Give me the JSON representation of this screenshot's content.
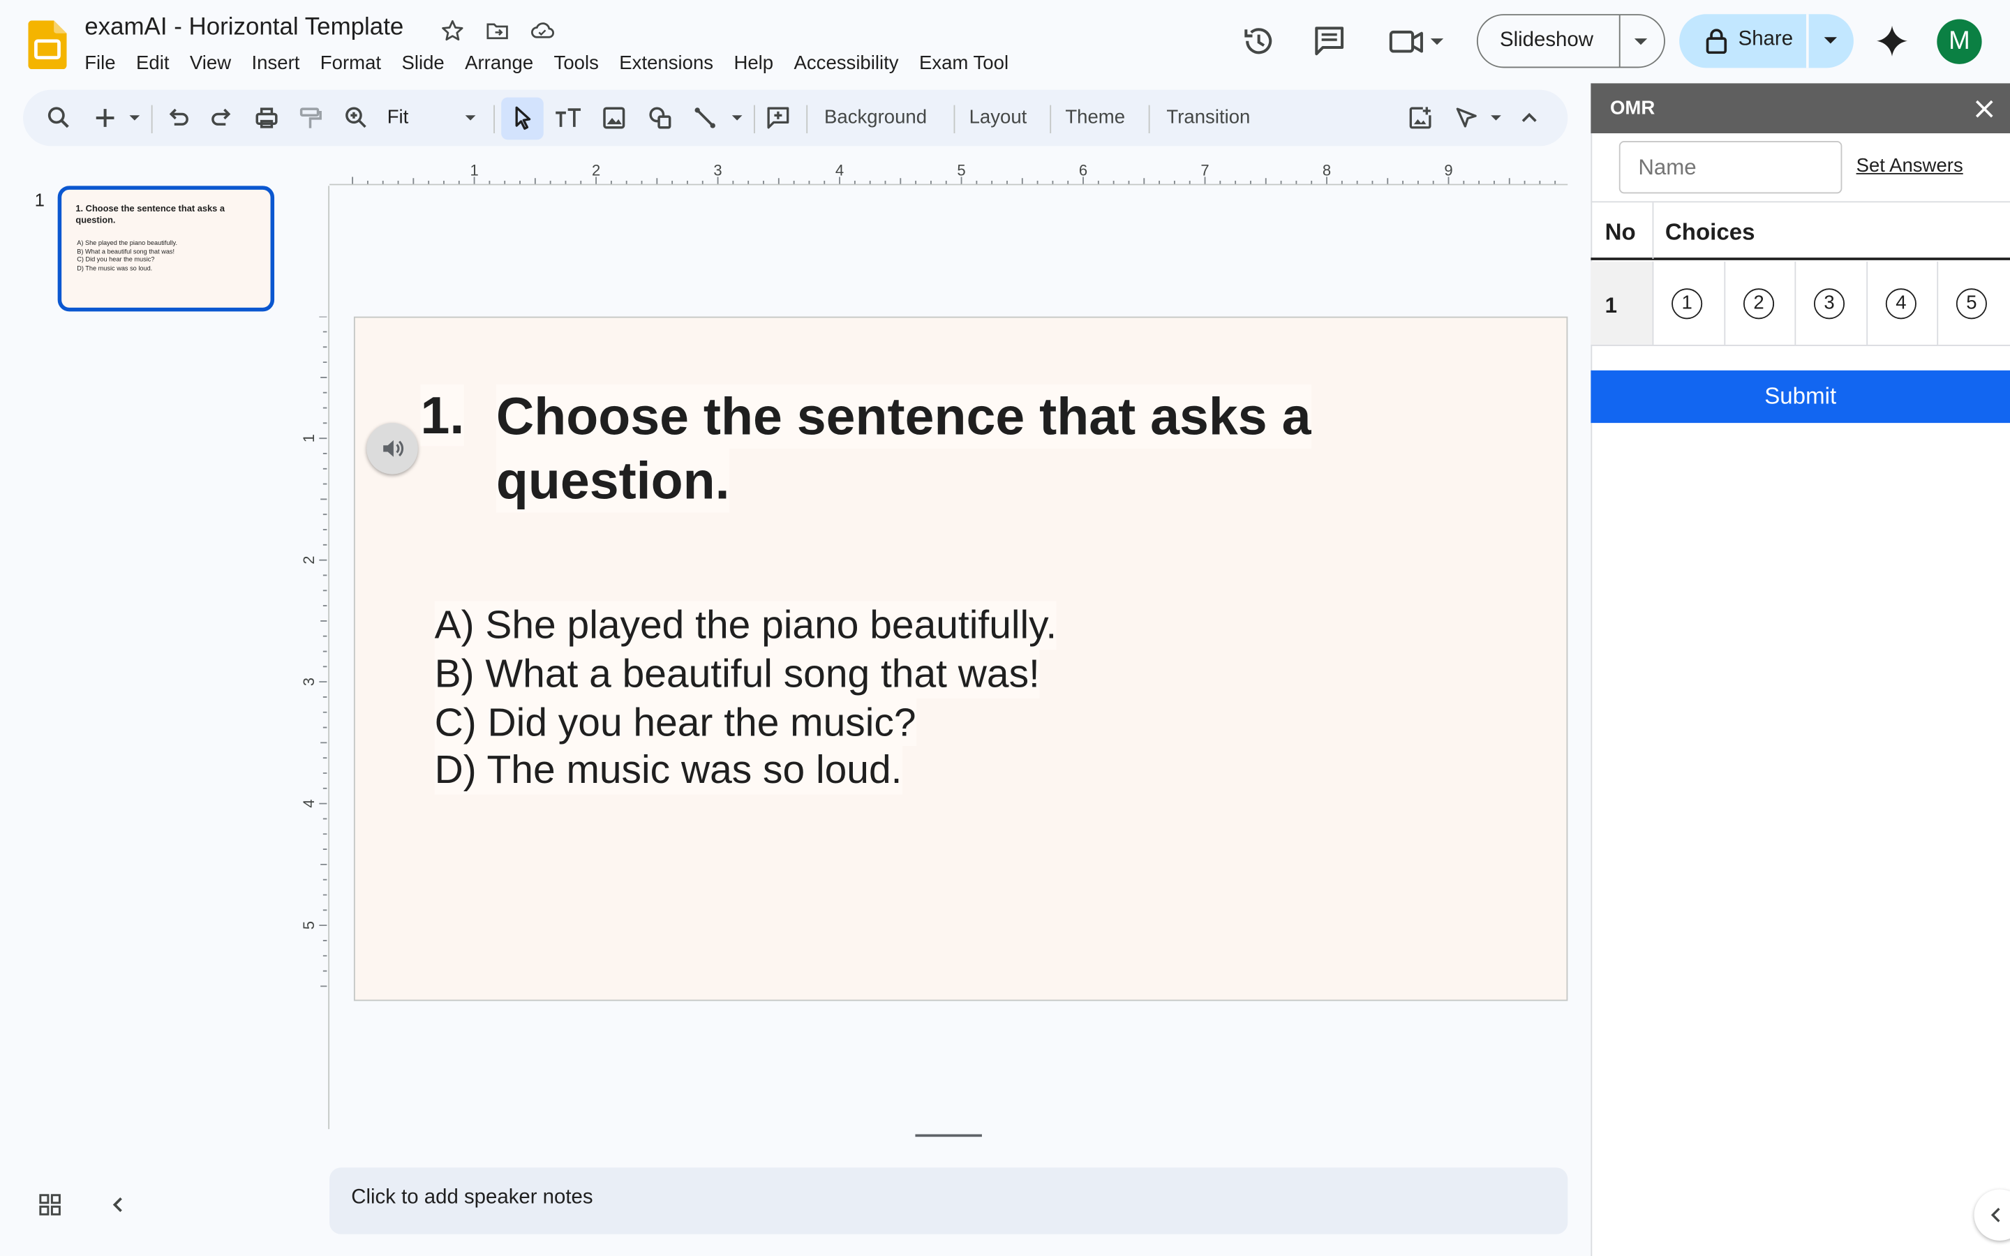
{
  "app": {
    "title": "examAI - Horizontal Template",
    "menu": [
      "File",
      "Edit",
      "View",
      "Insert",
      "Format",
      "Slide",
      "Arrange",
      "Tools",
      "Extensions",
      "Help",
      "Accessibility",
      "Exam Tool"
    ],
    "slideshow_label": "Slideshow",
    "share_label": "Share",
    "avatar_letter": "M",
    "brand_color": "#f4b400"
  },
  "toolbar": {
    "zoom": "Fit",
    "background": "Background",
    "layout": "Layout",
    "theme": "Theme",
    "transition": "Transition"
  },
  "filmstrip": {
    "slides": [
      {
        "number": "1",
        "question": "1.  Choose the sentence that asks a question.",
        "options": [
          "A) She played the piano beautifully.",
          "B) What a beautiful song that was!",
          "C) Did you hear the music?",
          "D) The music was so loud."
        ]
      }
    ]
  },
  "ruler": {
    "horizontal": [
      "1",
      "2",
      "3",
      "4",
      "5",
      "6",
      "7",
      "8",
      "9"
    ],
    "vertical": [
      "1",
      "2",
      "3",
      "4",
      "5"
    ]
  },
  "slide": {
    "question_number": "1.",
    "question_line1": "Choose the sentence that asks a",
    "question_line2": "question.",
    "options": [
      "A) She played the piano beautifully.",
      "B) What a beautiful song that was!",
      "C) Did you hear the music?",
      "D) The music was so loud."
    ],
    "background_color": "#fdf6f1"
  },
  "notes": {
    "placeholder": "Click to add speaker notes"
  },
  "omr": {
    "title": "OMR",
    "name_placeholder": "Name",
    "set_answers": "Set Answers",
    "col_no": "No",
    "col_choices": "Choices",
    "rows": [
      {
        "no": "1",
        "choices": [
          "1",
          "2",
          "3",
          "4",
          "5"
        ]
      }
    ],
    "submit": "Submit",
    "submit_color": "#1266f1"
  }
}
